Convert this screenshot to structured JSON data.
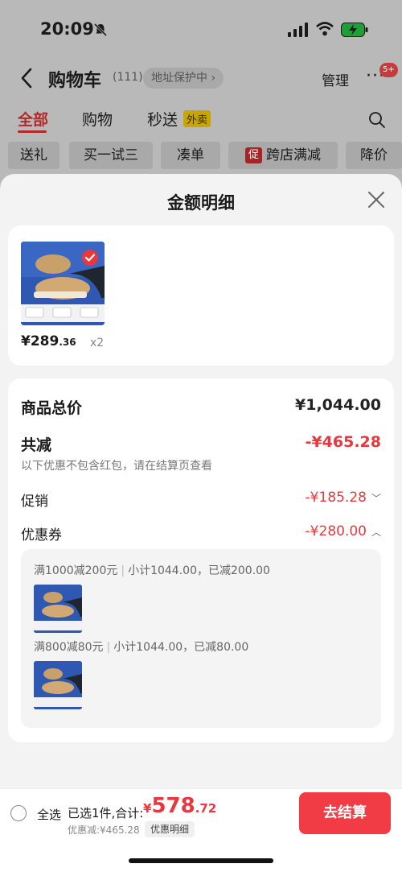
{
  "status_bar": {
    "time": "20:09"
  },
  "nav": {
    "title": "购物车",
    "count": "(111)",
    "address_protect": "地址保护中",
    "manage": "管理",
    "more": "···",
    "badge": "5+"
  },
  "tabs": [
    {
      "label": "全部",
      "active": true
    },
    {
      "label": "购物",
      "active": false
    },
    {
      "label": "秒送",
      "active": false
    }
  ],
  "tab_tag": "外卖",
  "chips": [
    "送礼",
    "买一试三",
    "凑单",
    "跨店满减",
    "降价"
  ],
  "chip_tag": "促",
  "sheet": {
    "title": "金额明细",
    "product": {
      "price_int": "¥289",
      "price_dec": ".36",
      "qty": "x2"
    },
    "total_label": "商品总价",
    "total_value": "¥1,044.00",
    "reduce_label": "共减",
    "reduce_value": "-¥465.28",
    "note": "以下优惠不包含红包，请在结算页查看",
    "promo_label": "促销",
    "promo_value": "-¥185.28",
    "coupon_label": "优惠券",
    "coupon_value": "-¥280.00",
    "coupons": [
      {
        "rule": "满1000减200元",
        "detail": "小计1044.00，已减200.00"
      },
      {
        "rule": "满800减80元",
        "detail": "小计1044.00，已减80.00"
      }
    ]
  },
  "footer": {
    "select_all": "全选",
    "selected_info": "已选1件,合计:",
    "total_symbol": "¥",
    "total_int": "578",
    "total_dec": ".72",
    "discount": "优惠减:¥465.28",
    "detail_button": "优惠明细",
    "checkout": "去结算"
  },
  "colors": {
    "accent_red": "#e8383d",
    "checkout_red": "#f13b45"
  }
}
